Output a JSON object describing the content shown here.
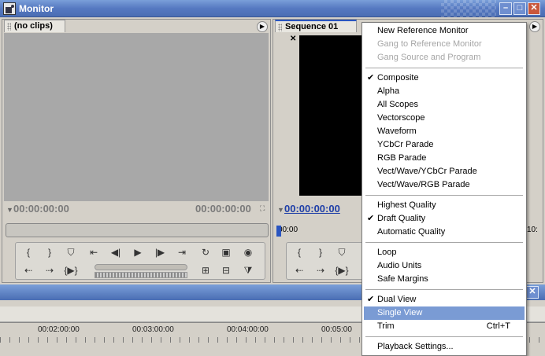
{
  "window": {
    "title": "Monitor"
  },
  "source": {
    "tab_label": "(no clips)",
    "timecode_left": "00:00:00:00",
    "timecode_right": "00:00:00:00"
  },
  "program": {
    "tab_label": "Sequence 01",
    "timecode": "00:00:00:00",
    "ruler_start": "00:00",
    "ruler_end": "10:"
  },
  "timeline": {
    "ruler_labels": [
      "00:02:00:00",
      "00:03:00:00",
      "00:04:00:00",
      "00:05:00"
    ]
  },
  "menu": {
    "items": [
      {
        "label": "New Reference Monitor",
        "enabled": true,
        "checked": false
      },
      {
        "label": "Gang to Reference Monitor",
        "enabled": false,
        "checked": false
      },
      {
        "label": "Gang Source and Program",
        "enabled": false,
        "checked": false
      },
      {
        "label": "Composite",
        "enabled": true,
        "checked": true
      },
      {
        "label": "Alpha",
        "enabled": true,
        "checked": false
      },
      {
        "label": "All Scopes",
        "enabled": true,
        "checked": false
      },
      {
        "label": "Vectorscope",
        "enabled": true,
        "checked": false
      },
      {
        "label": "Waveform",
        "enabled": true,
        "checked": false
      },
      {
        "label": "YCbCr Parade",
        "enabled": true,
        "checked": false
      },
      {
        "label": "RGB Parade",
        "enabled": true,
        "checked": false
      },
      {
        "label": "Vect/Wave/YCbCr Parade",
        "enabled": true,
        "checked": false
      },
      {
        "label": "Vect/Wave/RGB Parade",
        "enabled": true,
        "checked": false
      },
      {
        "label": "Highest Quality",
        "enabled": true,
        "checked": false
      },
      {
        "label": "Draft Quality",
        "enabled": true,
        "checked": true
      },
      {
        "label": "Automatic Quality",
        "enabled": true,
        "checked": false
      },
      {
        "label": "Loop",
        "enabled": true,
        "checked": false
      },
      {
        "label": "Audio Units",
        "enabled": true,
        "checked": false
      },
      {
        "label": "Safe Margins",
        "enabled": true,
        "checked": false
      },
      {
        "label": "Dual View",
        "enabled": true,
        "checked": true
      },
      {
        "label": "Single View",
        "enabled": true,
        "checked": false,
        "highlighted": true
      },
      {
        "label": "Trim",
        "enabled": true,
        "checked": false,
        "shortcut": "Ctrl+T"
      },
      {
        "label": "Playback Settings...",
        "enabled": true,
        "checked": false
      }
    ],
    "check_glyph": "✔"
  },
  "colors": {
    "titlebar": "#5679c1",
    "menu_highlight": "#7a9bd4",
    "active_timecode": "#1f3fa8"
  }
}
